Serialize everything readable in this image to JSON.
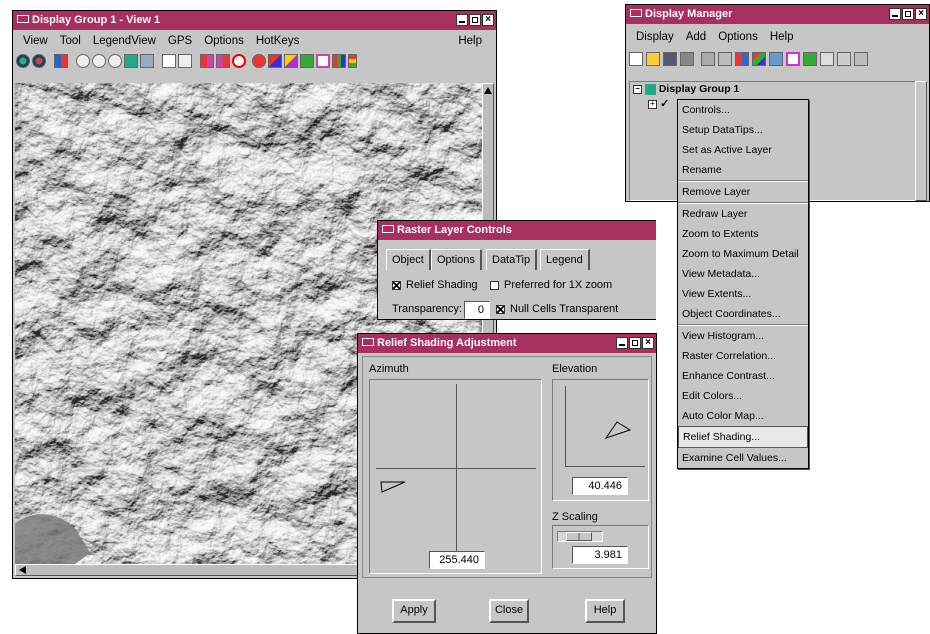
{
  "view_window": {
    "title": "Display Group 1 - View 1",
    "menu": [
      "View",
      "Tool",
      "LegendView",
      "GPS",
      "Options",
      "HotKeys"
    ],
    "help": "Help",
    "toolbar_icons": [
      "zoom-in-icon",
      "zoom-out-icon",
      "pan-icon",
      "zoom-box-icon",
      "zoom-all-icon",
      "zoom-previous-icon",
      "zoom-next-icon",
      "full-extent-icon",
      "scale-icon",
      "magnify-icon",
      "back-icon",
      "forward-icon",
      "stop-redraw-icon",
      "search-icon",
      "select-icon",
      "paint-icon",
      "legend-icon",
      "layout-icon",
      "colors-icon",
      "traffic-light-icon"
    ]
  },
  "display_manager": {
    "title": "Display Manager",
    "menu": [
      "Display",
      "Add",
      "Options",
      "Help"
    ],
    "tree_root": "Display Group 1",
    "context_menu": {
      "groups": [
        [
          "Controls...",
          "Setup DataTips...",
          "Set as Active Layer",
          "Rename"
        ],
        [
          "Remove Layer"
        ],
        [
          "Redraw Layer",
          "Zoom to Extents",
          "Zoom to Maximum Detail",
          "View Metadata...",
          "View Extents...",
          "Object Coordinates..."
        ],
        [
          "View Histogram...",
          "Raster Correlation...",
          "Enhance Contrast...",
          "Edit Colors...",
          "Auto Color Map...",
          "Relief Shading...",
          "Examine Cell Values..."
        ]
      ],
      "highlighted": "Relief Shading..."
    }
  },
  "raster_controls": {
    "title": "Raster Layer Controls",
    "tabs": [
      "Object",
      "Options",
      "DataTip",
      "Legend"
    ],
    "active_tab": "Options",
    "relief_shading_label": "Relief Shading",
    "relief_shading_checked": true,
    "preferred_label": "Preferred for 1X zoom",
    "preferred_checked": false,
    "transparency_label": "Transparency:",
    "transparency_value": "0",
    "null_cells_label": "Null Cells Transparent",
    "null_cells_checked": true
  },
  "relief_dialog": {
    "title": "Relief Shading Adjustment",
    "azimuth_label": "Azimuth",
    "azimuth_value": "255.440",
    "elevation_label": "Elevation",
    "elevation_value": "40.446",
    "zscaling_label": "Z Scaling",
    "zscaling_value": "3.981",
    "apply": "Apply",
    "close": "Close",
    "help": "Help"
  }
}
